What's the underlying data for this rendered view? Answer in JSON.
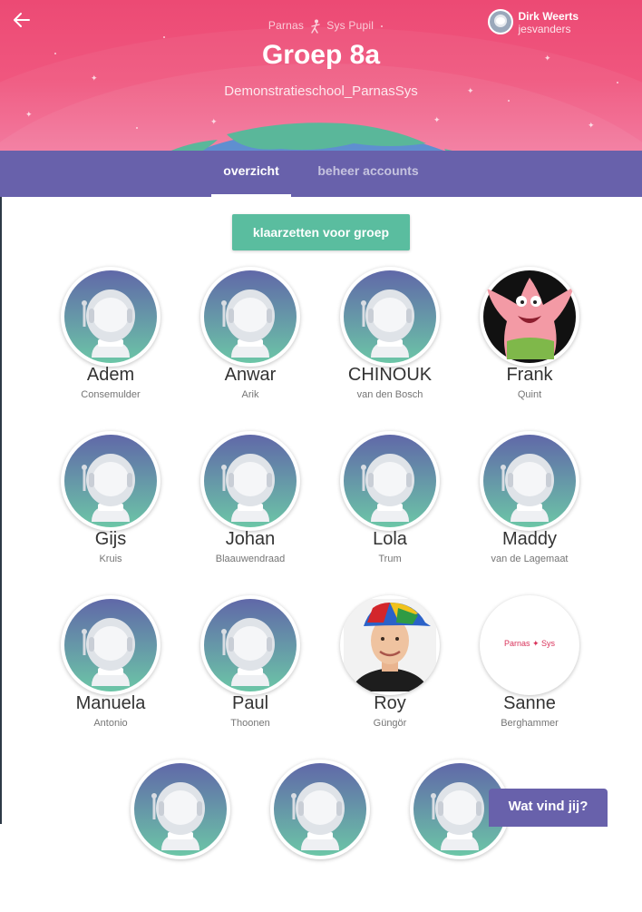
{
  "header": {
    "brand_left": "Parnas",
    "brand_middle": "Sys",
    "brand_right": "Pupil",
    "title": "Groep 8a",
    "subtitle": "Demonstratieschool_ParnasSys",
    "user_name": "Dirk Weerts",
    "user_login": "jesvanders"
  },
  "tabs": [
    {
      "label": "overzicht",
      "active": true
    },
    {
      "label": "beheer accounts",
      "active": false
    }
  ],
  "actions": {
    "prepare_label": "klaarzetten voor groep",
    "feedback_label": "Wat vind jij?"
  },
  "students": [
    {
      "first": "Adem",
      "last": "Consemulder",
      "avatar": "astronaut-icon"
    },
    {
      "first": "Anwar",
      "last": "Arik",
      "avatar": "astronaut-icon"
    },
    {
      "first": "CHINOUK",
      "last": "van den Bosch",
      "avatar": "astronaut-icon"
    },
    {
      "first": "Frank",
      "last": "Quint",
      "avatar": "starfish-cartoon-photo"
    },
    {
      "first": "Gijs",
      "last": "Kruis",
      "avatar": "astronaut-icon"
    },
    {
      "first": "Johan",
      "last": "Blaauwendraad",
      "avatar": "astronaut-icon"
    },
    {
      "first": "Lola",
      "last": "Trum",
      "avatar": "astronaut-icon"
    },
    {
      "first": "Maddy",
      "last": "van de Lagemaat",
      "avatar": "astronaut-icon"
    },
    {
      "first": "Manuela",
      "last": "Antonio",
      "avatar": "astronaut-icon"
    },
    {
      "first": "Paul",
      "last": "Thoonen",
      "avatar": "astronaut-icon"
    },
    {
      "first": "Roy",
      "last": "Güngör",
      "avatar": "person-photo"
    },
    {
      "first": "Sanne",
      "last": "Berghammer",
      "avatar": "parnassys-logo",
      "logo_left": "Parnas",
      "logo_right": "Sys"
    },
    {
      "first": "",
      "last": "",
      "avatar": "astronaut-icon"
    },
    {
      "first": "",
      "last": "",
      "avatar": "astronaut-icon"
    },
    {
      "first": "",
      "last": "",
      "avatar": "astronaut-icon"
    }
  ],
  "colors": {
    "header_pink": "#ec4a74",
    "tab_bar": "#6861ab",
    "accent_green": "#5abd9f",
    "astronaut_top": "#6068a8",
    "astronaut_bottom": "#6cc6a7"
  }
}
